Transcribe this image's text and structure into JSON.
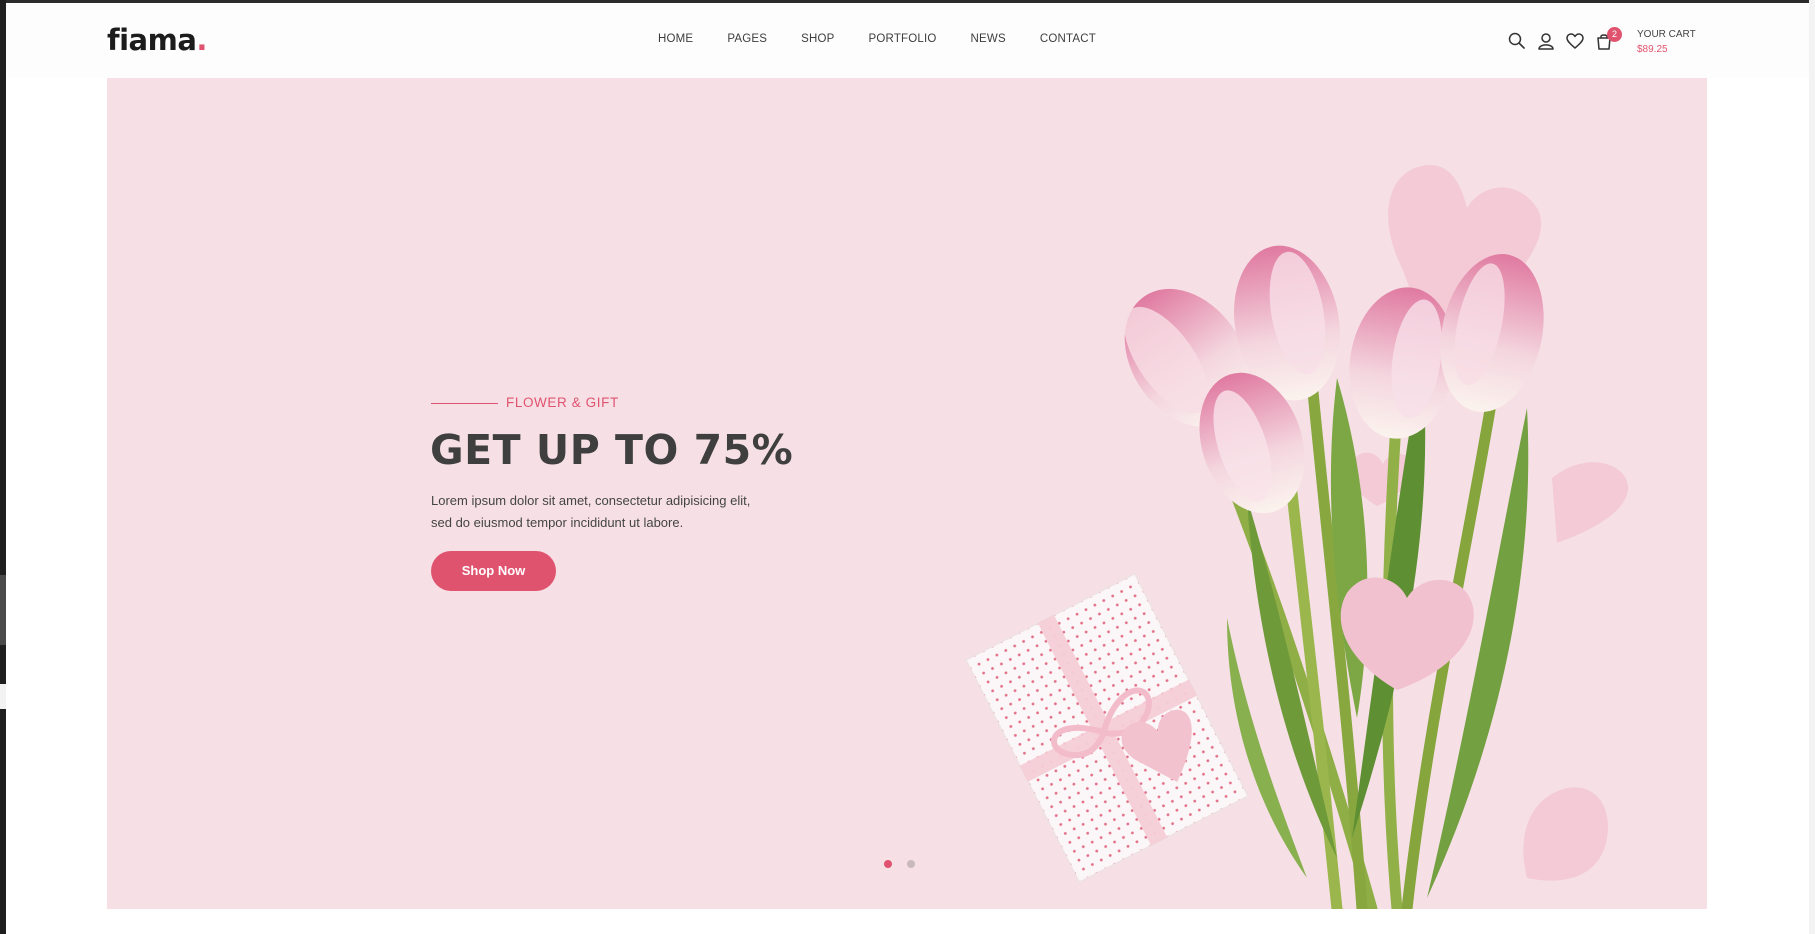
{
  "header": {
    "logo": {
      "text": "fiama",
      "dot": "."
    },
    "nav": [
      "HOME",
      "PAGES",
      "SHOP",
      "PORTFOLIO",
      "NEWS",
      "CONTACT"
    ],
    "icons": [
      "search-icon",
      "user-icon",
      "heart-icon",
      "cart-bag-icon"
    ],
    "cart": {
      "badge_count": "2",
      "title": "YOUR CART",
      "total": "$89.25"
    }
  },
  "hero": {
    "eyebrow": "FLOWER & GIFT",
    "headline": "GET UP TO 75%",
    "description_line1": "Lorem ipsum dolor sit amet, consectetur adipisicing elit,",
    "description_line2": "sed do eiusmod tempor incididunt ut labore.",
    "button_label": "Shop Now",
    "slider": {
      "slides": 2,
      "active": 1
    }
  },
  "colors": {
    "accent": "#e0536f",
    "hero_background": "#f6e0e6",
    "heading": "#3f3f3f"
  }
}
